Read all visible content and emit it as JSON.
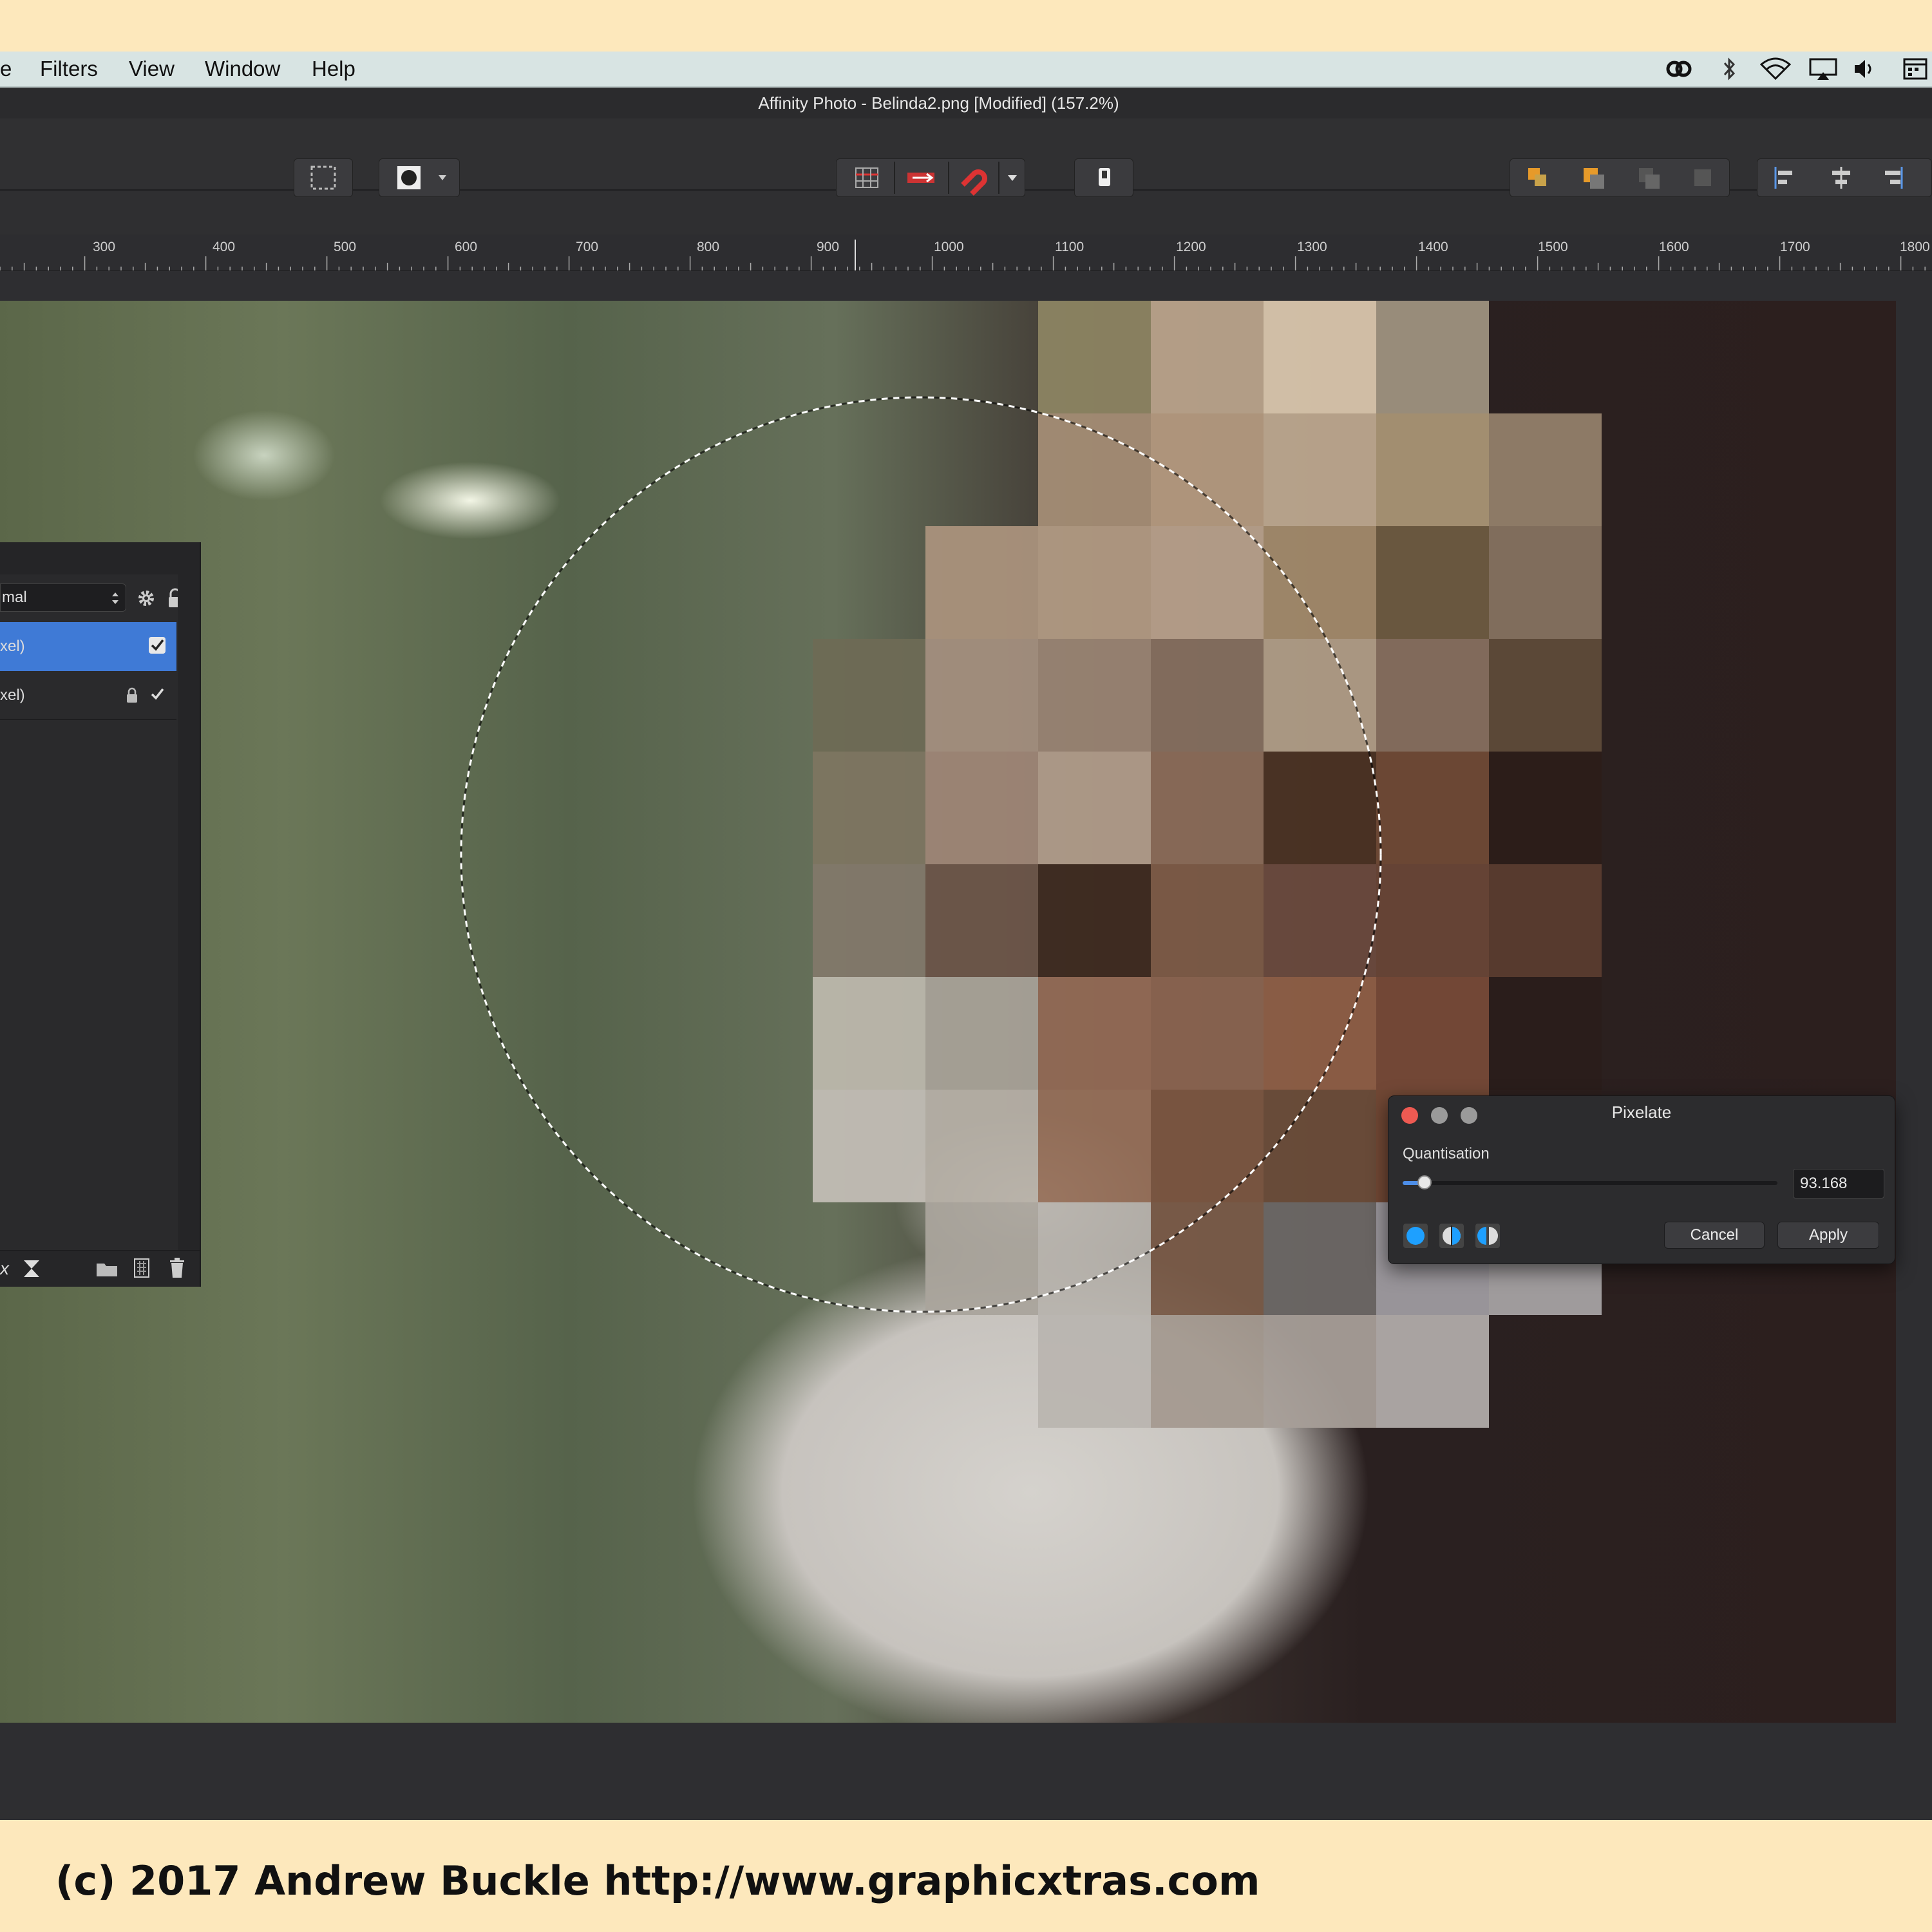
{
  "menubar": {
    "items": [
      "e",
      "Filters",
      "View",
      "Window",
      "Help"
    ],
    "status_icons": [
      "creative-cloud-icon",
      "bluetooth-icon",
      "wifi-icon",
      "airplay-icon",
      "volume-icon",
      "calendar-icon"
    ]
  },
  "window": {
    "title": "Affinity Photo - Belinda2.png [Modified] (157.2%)"
  },
  "toolbar": {
    "buttons": [
      "marquee-selection-icon",
      "selection-mode-icon",
      "snapping-grid-icon",
      "snapping-move-icon",
      "snapping-magnet-icon",
      "snapping-dropdown-icon",
      "quick-mask-icon",
      "arrange-front-icon",
      "arrange-forward-icon",
      "arrange-backward-icon",
      "arrange-back-icon",
      "align-left-icon",
      "align-center-icon",
      "align-right-icon"
    ]
  },
  "ruler": {
    "labels": [
      "300",
      "400",
      "500",
      "600",
      "700",
      "800",
      "900",
      "1000",
      "1100",
      "1200",
      "1300",
      "1400",
      "1500",
      "1600",
      "1700",
      "1800"
    ]
  },
  "layers_panel": {
    "blend_mode": "mal",
    "layers": [
      {
        "label": "xel)",
        "selected": true
      },
      {
        "label": "xel)",
        "selected": false
      }
    ],
    "footer_icons": [
      "fx-icon",
      "adjustment-icon",
      "group-folder-icon",
      "add-pixel-layer-icon",
      "trash-icon"
    ]
  },
  "dialog": {
    "title": "Pixelate",
    "quantisation_label": "Quantisation",
    "quantisation_value": "93.168",
    "slider_fraction": 0.058,
    "cancel_label": "Cancel",
    "apply_label": "Apply",
    "mode_icons": [
      "full-preview-icon",
      "split-preview-icon",
      "mirror-preview-icon"
    ]
  },
  "footer": {
    "copyright": "(c) 2017 Andrew Buckle http://www.graphicxtras.com"
  },
  "colors": {
    "accent_blue": "#3f7ad6",
    "close_red": "#ee5a52",
    "frame_cream": "#fde8bc",
    "menubar_bg": "#d8e4e3",
    "app_bg": "#2f2f31"
  }
}
